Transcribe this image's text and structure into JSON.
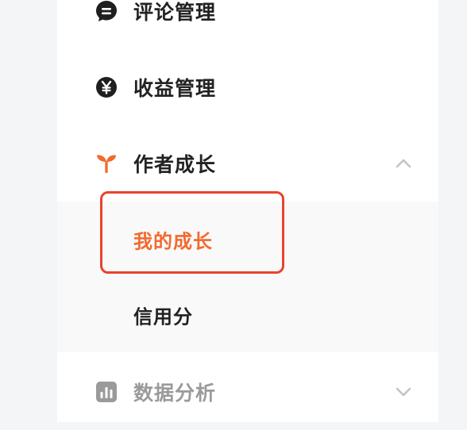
{
  "menu": {
    "comment": {
      "label": "评论管理",
      "icon": "comment-icon"
    },
    "income": {
      "label": "收益管理",
      "icon": "yen-icon"
    },
    "growth": {
      "label": "作者成长",
      "icon": "sprout-icon",
      "expanded": true,
      "chevron": "chevron-up-icon",
      "children": [
        {
          "label": "我的成长",
          "active": true
        },
        {
          "label": "信用分",
          "active": false
        }
      ]
    },
    "analytics": {
      "label": "数据分析",
      "icon": "bar-chart-icon",
      "expanded": false,
      "chevron": "chevron-down-icon"
    }
  },
  "colors": {
    "accent": "#f26a2e",
    "highlight_border": "#e8432e",
    "text": "#222222",
    "muted": "#9a9a9a",
    "icon_dark": "#1f1f1f"
  }
}
